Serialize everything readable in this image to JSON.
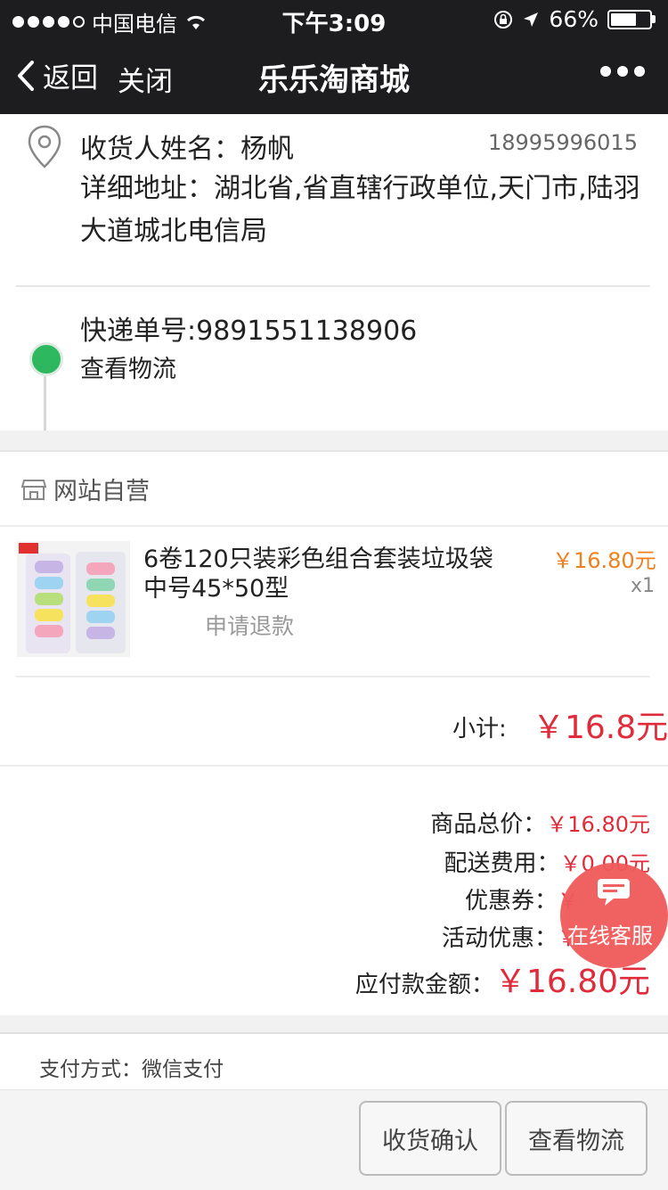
{
  "status_bar": {
    "carrier": "中国电信",
    "time": "下午3:09",
    "battery": "66%",
    "battery_level": 0.66
  },
  "nav": {
    "back_label": "返回",
    "close_label": "关闭",
    "title": "乐乐淘商城"
  },
  "address": {
    "name_line": "收货人姓名：杨帆",
    "phone": "18995996015",
    "detail": "详细地址：湖北省,省直辖行政单位,天门市,陆羽大道城北电信局",
    "tracking": "快递单号:9891551138906",
    "view_logistics": "查看物流"
  },
  "shop": {
    "name": "网站自营",
    "product": {
      "title": "6卷120只装彩色组合套装垃圾袋中号45*50型",
      "price": "￥16.80元",
      "qty": "x1",
      "refund": "申请退款"
    },
    "subtotal_label": "小计:",
    "subtotal_value": "￥16.8元"
  },
  "summary": {
    "goods_label": "商品总价：",
    "goods_value": "￥16.80元",
    "shipping_label": "配送费用：",
    "shipping_value": "￥0.00元",
    "coupon_label": "优惠券：",
    "coupon_value": "￥",
    "promo_label": "活动优惠：",
    "promo_value": "￥",
    "total_label": "应付款金额：",
    "total_value": "￥16.80元"
  },
  "customer_service": {
    "label": "在线客服"
  },
  "payment": {
    "label": "支付方式：微信支付"
  },
  "footer": {
    "confirm_label": "收货确认",
    "logistics_label": "查看物流"
  },
  "colors": {
    "topbar": "#1d1d1f",
    "price_red": "#e02b3a",
    "price_orange": "#f0801e",
    "timeline_green": "#2db85f",
    "cs_bubble": "#f05a5a"
  }
}
